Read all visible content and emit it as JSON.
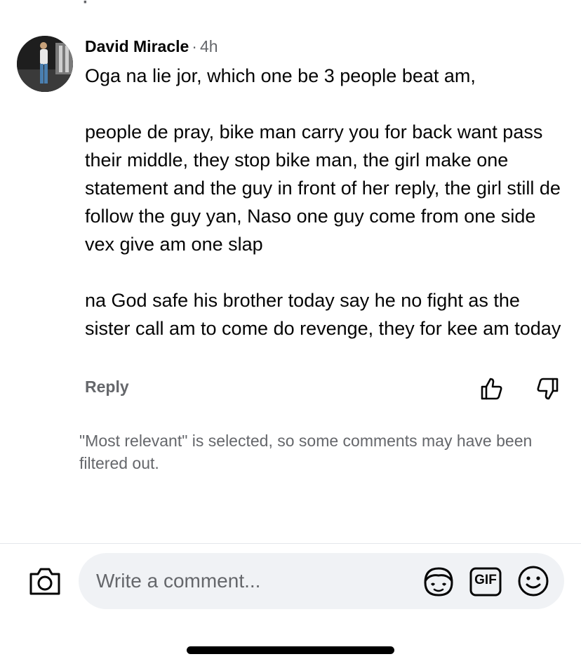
{
  "comment": {
    "author": "David Miracle",
    "separator": "·",
    "time": "4h",
    "paragraphs": [
      "Oga na lie jor, which one be 3 people beat am,",
      "people de pray, bike man carry you for back want pass their middle, they stop bike man, the girl make one statement and the guy in front of her reply, the girl still de follow the guy yan, Naso one guy come from one side vex give am one slap",
      "na God safe his brother today say he no fight as the sister call am to come do revenge, they for kee am today"
    ],
    "reply_label": "Reply"
  },
  "filter_note": "\"Most relevant\" is selected, so some comments may have been filtered out.",
  "composer": {
    "placeholder": "Write a comment...",
    "gif_label": "GIF"
  },
  "icons": {
    "like": "thumbs-up-outline",
    "dislike": "thumbs-down-outline",
    "camera": "camera-outline",
    "avatar_sticker": "avatar-sticker-outline",
    "gif": "gif-outline",
    "emoji": "smiley-outline"
  },
  "colors": {
    "text": "#050505",
    "secondary": "#65676b",
    "input_bg": "#f0f2f5",
    "divider": "#e4e6eb"
  }
}
